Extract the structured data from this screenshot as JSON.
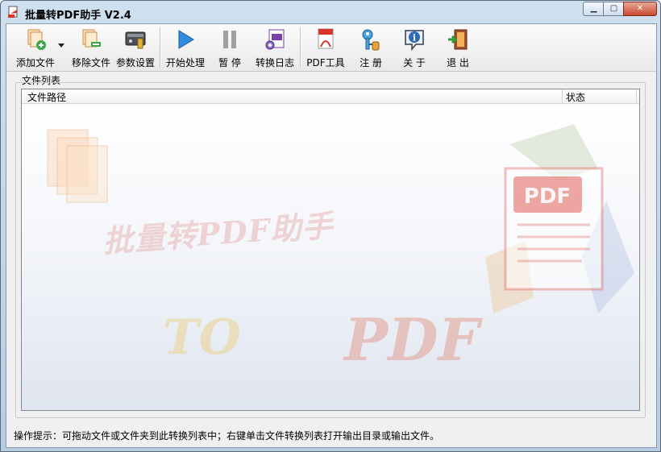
{
  "window": {
    "title": "批量转PDF助手 V2.4"
  },
  "toolbar": {
    "add_file": "添加文件",
    "remove_file": "移除文件",
    "settings": "参数设置",
    "start": "开始处理",
    "pause": "暂 停",
    "log": "转换日志",
    "pdf_tools": "PDF工具",
    "register": "注 册",
    "about": "关 于",
    "exit": "退 出"
  },
  "file_list": {
    "group_label": "文件列表",
    "columns": [
      "文件路径",
      "状态"
    ],
    "rows": []
  },
  "watermark": {
    "title": "批量转PDF助手",
    "to": "TO",
    "pdf": "PDF"
  },
  "status": {
    "hint": "操作提示：可拖动文件或文件夹到此转换列表中；右键单击文件转换列表打开输出目录或输出文件。"
  },
  "colors": {
    "accent": "#d9342b",
    "titlebar": "#c4d7ea"
  }
}
